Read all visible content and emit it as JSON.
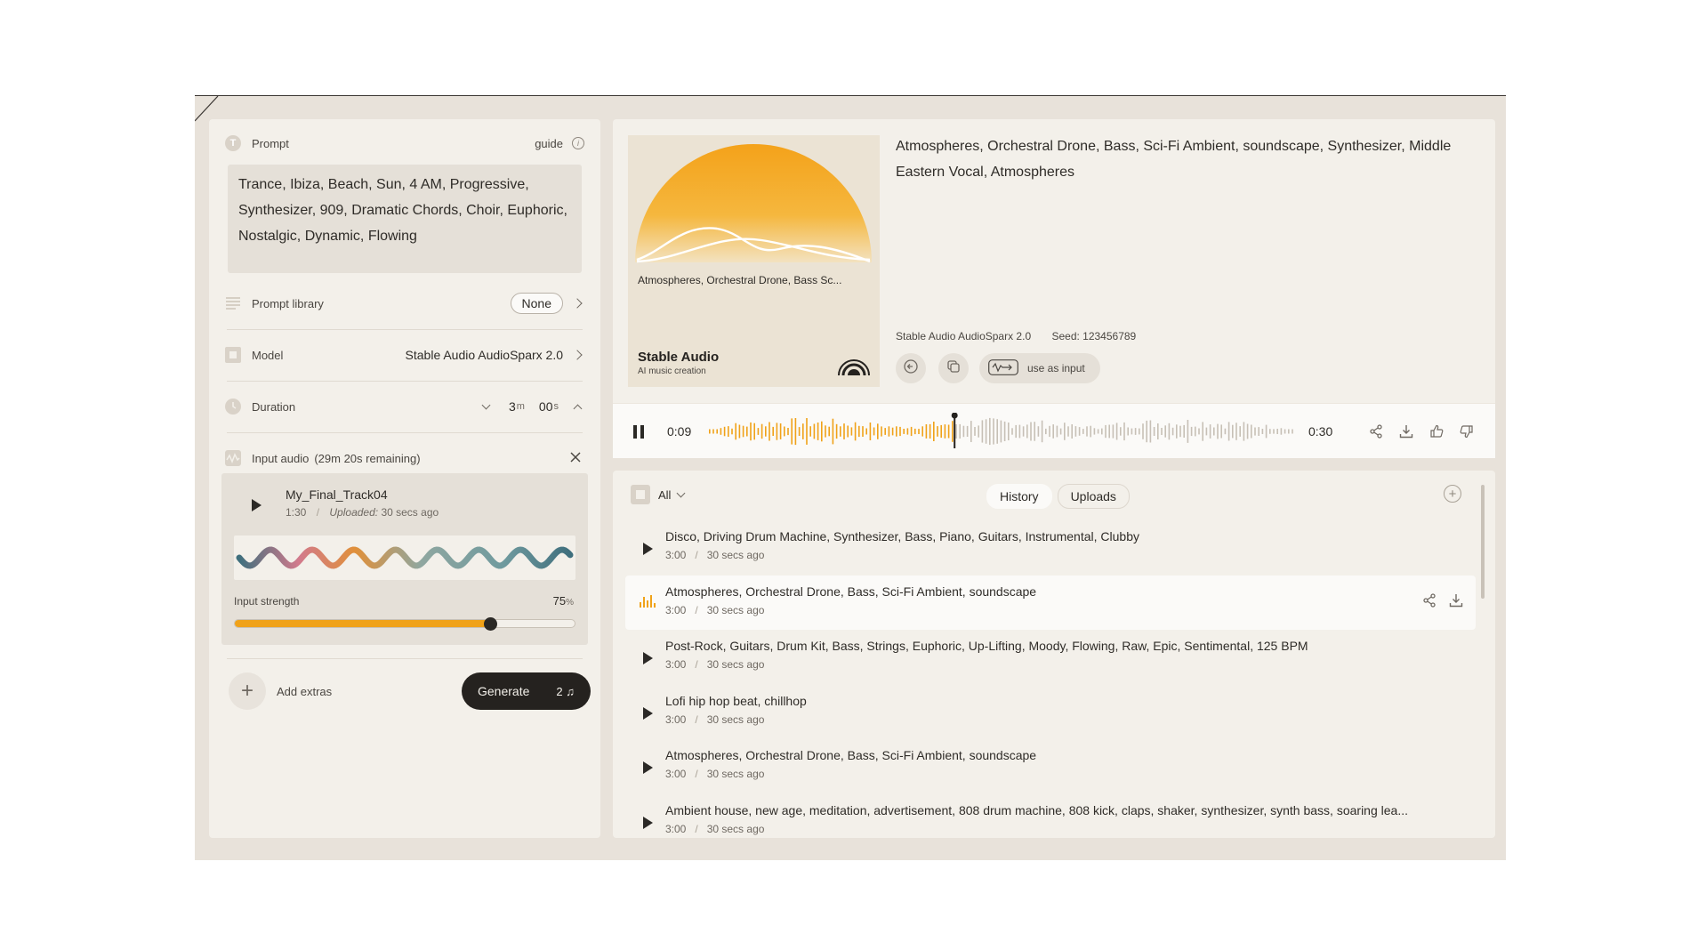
{
  "prompt": {
    "label": "Prompt",
    "guide_label": "guide",
    "text": "Trance, Ibiza, Beach, Sun, 4 AM, Progressive, Synthesizer, 909, Dramatic Chords, Choir, Euphoric, Nostalgic, Dynamic, Flowing"
  },
  "prompt_library": {
    "label": "Prompt library",
    "value": "None"
  },
  "model": {
    "label": "Model",
    "value": "Stable Audio AudioSparx 2.0"
  },
  "duration": {
    "label": "Duration",
    "minutes": "3",
    "minutes_unit": "m",
    "seconds": "00",
    "seconds_unit": "s"
  },
  "input_audio": {
    "label": "Input audio",
    "remaining": "(29m 20s remaining)",
    "track_name": "My_Final_Track04",
    "track_length": "1:30",
    "uploaded_label": "Uploaded:",
    "uploaded_time": "30 secs ago",
    "strength_label": "Input strength",
    "strength_value": "75",
    "strength_unit": "%",
    "strength_fraction": 0.75
  },
  "footer": {
    "add_extras_label": "Add extras",
    "generate_label": "Generate",
    "generate_cost": "2"
  },
  "current_track": {
    "title": "Atmospheres, Orchestral Drone, Bass, Sci-Fi Ambient, soundscape, Synthesizer, Middle Eastern Vocal, Atmospheres",
    "cover_caption": "Atmospheres, Orchestral Drone, Bass Sc...",
    "cover_brand": "Stable Audio",
    "cover_sub": "AI music creation",
    "model": "Stable Audio AudioSparx 2.0",
    "seed": "Seed: 123456789",
    "use_as_input_label": "use as input",
    "time_current": "0:09",
    "time_total": "0:30",
    "progress_fraction": 0.42
  },
  "history": {
    "filter_label": "All",
    "tabs": [
      {
        "label": "History"
      },
      {
        "label": "Uploads"
      }
    ],
    "items": [
      {
        "title": "Disco, Driving Drum Machine, Synthesizer, Bass, Piano, Guitars, Instrumental, Clubby",
        "duration": "3:00",
        "time": "30 secs ago"
      },
      {
        "title": "Atmospheres, Orchestral Drone, Bass, Sci-Fi Ambient, soundscape",
        "duration": "3:00",
        "time": "30 secs ago"
      },
      {
        "title": "Post-Rock, Guitars, Drum Kit, Bass, Strings, Euphoric, Up-Lifting, Moody, Flowing, Raw, Epic, Sentimental, 125 BPM",
        "duration": "3:00",
        "time": "30 secs ago"
      },
      {
        "title": "Lofi hip hop beat, chillhop",
        "duration": "3:00",
        "time": "30 secs ago"
      },
      {
        "title": "Atmospheres, Orchestral Drone, Bass, Sci-Fi Ambient, soundscape",
        "duration": "3:00",
        "time": "30 secs ago"
      },
      {
        "title": "Ambient house, new age, meditation, advertisement, 808 drum machine, 808 kick, claps, shaker, synthesizer, synth bass, soaring lea...",
        "duration": "3:00",
        "time": "30 secs ago"
      }
    ],
    "separator": "/"
  },
  "colors": {
    "accent": "#f0a219",
    "panel": "#f3f0ea",
    "frame": "#e8e2da",
    "dark": "#25221f"
  },
  "icons": [
    "text-icon",
    "info-icon",
    "list-icon",
    "model-icon",
    "clock-icon",
    "input-audio-icon",
    "close-icon",
    "play-icon",
    "pause-icon",
    "share-icon",
    "download-icon",
    "thumbs-up-icon",
    "thumbs-down-icon",
    "copy-icon",
    "back-icon",
    "plus-icon",
    "chevron-icon",
    "playing-bars-icon"
  ]
}
